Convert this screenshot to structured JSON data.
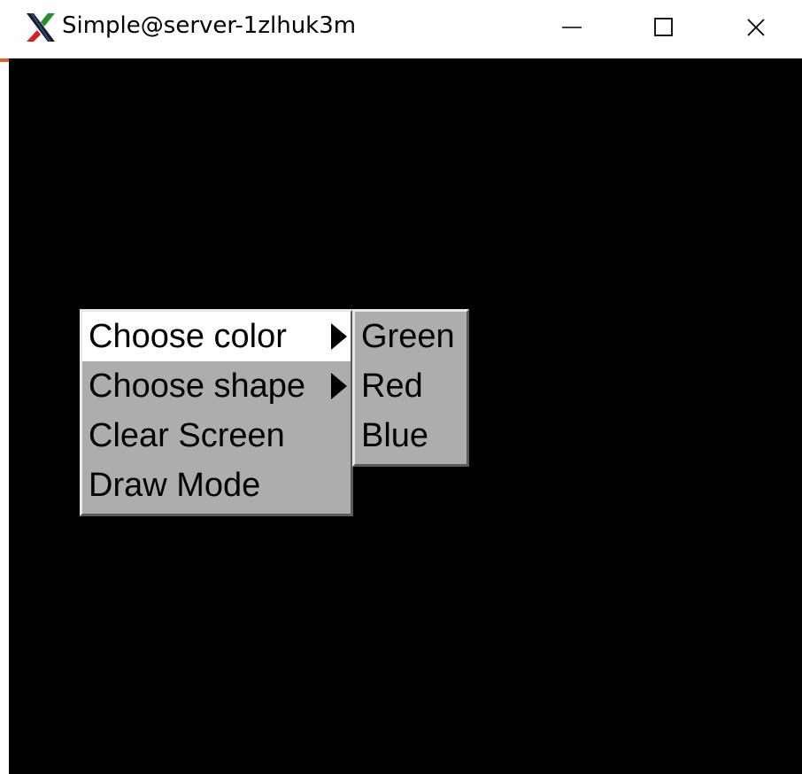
{
  "window": {
    "title": "Simple@server-1zlhuk3m",
    "icon": "x11-logo-icon",
    "controls": {
      "minimize_icon": "minimize-icon",
      "maximize_icon": "maximize-icon",
      "close_icon": "close-icon"
    }
  },
  "main_menu": {
    "items": [
      {
        "label": "Choose color",
        "has_submenu": true,
        "highlighted": true
      },
      {
        "label": "Choose shape",
        "has_submenu": true,
        "highlighted": false
      },
      {
        "label": "Clear Screen",
        "has_submenu": false,
        "highlighted": false
      },
      {
        "label": "Draw Mode",
        "has_submenu": false,
        "highlighted": false
      }
    ]
  },
  "color_submenu": {
    "items": [
      {
        "label": "Green"
      },
      {
        "label": "Red"
      },
      {
        "label": "Blue"
      }
    ]
  },
  "colors": {
    "canvas_bg": "#000000",
    "menu_bg": "#adadad",
    "menu_highlight": "#ffffff",
    "titlebar_bg": "#ffffff"
  }
}
